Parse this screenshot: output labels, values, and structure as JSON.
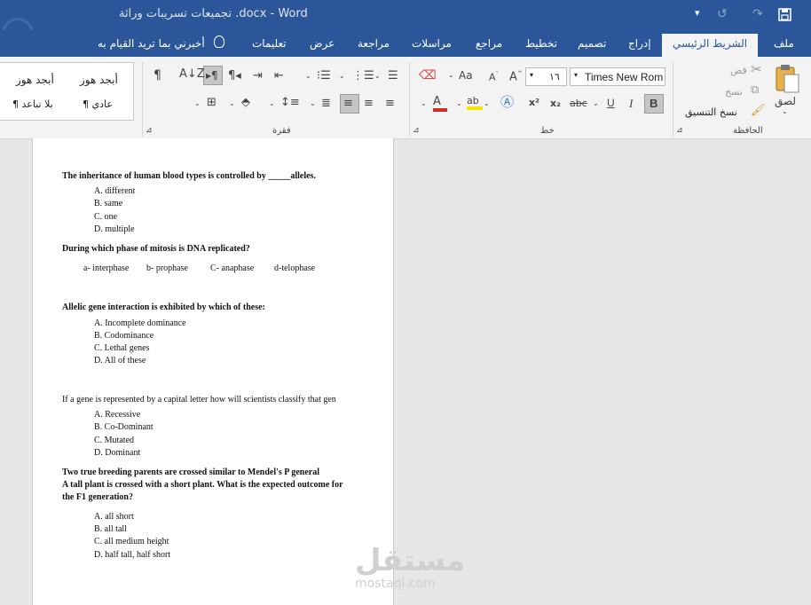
{
  "window": {
    "title": "تجميعات تسريبات وراثة .docx  -  Word",
    "qat": {
      "save_icon": "save-icon",
      "undo_icon": "undo-icon",
      "redo_icon": "redo-icon",
      "customize_icon": "chevron-down-icon"
    }
  },
  "tabs": {
    "file": "ملف",
    "home": "الشريط الرئيسي",
    "insert": "إدراج",
    "design": "تصميم",
    "layout": "تخطيط",
    "references": "مراجع",
    "mailings": "مراسلات",
    "review": "مراجعة",
    "view": "عرض",
    "help": "تعليمات",
    "tell_me": "أخبرني بما تريد القيام به"
  },
  "ribbon": {
    "clipboard": {
      "label": "الحافظة",
      "paste": "لصق",
      "cut": "قص",
      "copy": "نسخ",
      "format_painter": "نسخ التنسيق"
    },
    "font": {
      "label": "خط",
      "font_name": "Times New Rom",
      "font_size": "١٦",
      "bold": "B",
      "italic": "I",
      "underline": "U",
      "strike": "abc",
      "subscript": "x₂",
      "superscript": "x²",
      "font_color_letter": "A",
      "case_label": "Aa"
    },
    "paragraph": {
      "label": "فقرة"
    },
    "styles": {
      "normal": "¶ عادي",
      "no_spacing": "¶ بلا تباعد",
      "sample1": "أبجد هوز",
      "sample2": "أبجد هوز"
    }
  },
  "document": {
    "q1": {
      "text": "The inheritance of human blood types is controlled by _____alleles.",
      "options": [
        "A. different",
        "B. same",
        "C. one",
        "D. multiple"
      ]
    },
    "q2": {
      "text": "During which phase of mitosis is DNA replicated?",
      "options": [
        "a- interphase",
        "b- prophase",
        "C- anaphase",
        "d-telophase"
      ]
    },
    "q3": {
      "text": "Allelic gene interaction is exhibited by which of these:",
      "options": [
        "A. Incomplete dominance",
        "B. Codominance",
        "C. Lethal genes",
        "D. All of these"
      ]
    },
    "q4": {
      "text": "If a gene is represented by a capital letter how will scientists classify that gen",
      "options": [
        "A. Recessive",
        "B. Co-Dominant",
        "C. Mutated",
        "D. Dominant"
      ]
    },
    "q5": {
      "line1": "Two true breeding parents are crossed similar to Mendel's P general",
      "line2": "A tall plant is crossed with a short plant. What is the expected outcome for",
      "line3": "the F1 generation?",
      "options": [
        "A. all short",
        "B. all tall",
        "C. all medium height",
        "D. half tall, half short"
      ]
    }
  },
  "watermark": {
    "ar": "مستقل",
    "en": "mostaql.com"
  }
}
